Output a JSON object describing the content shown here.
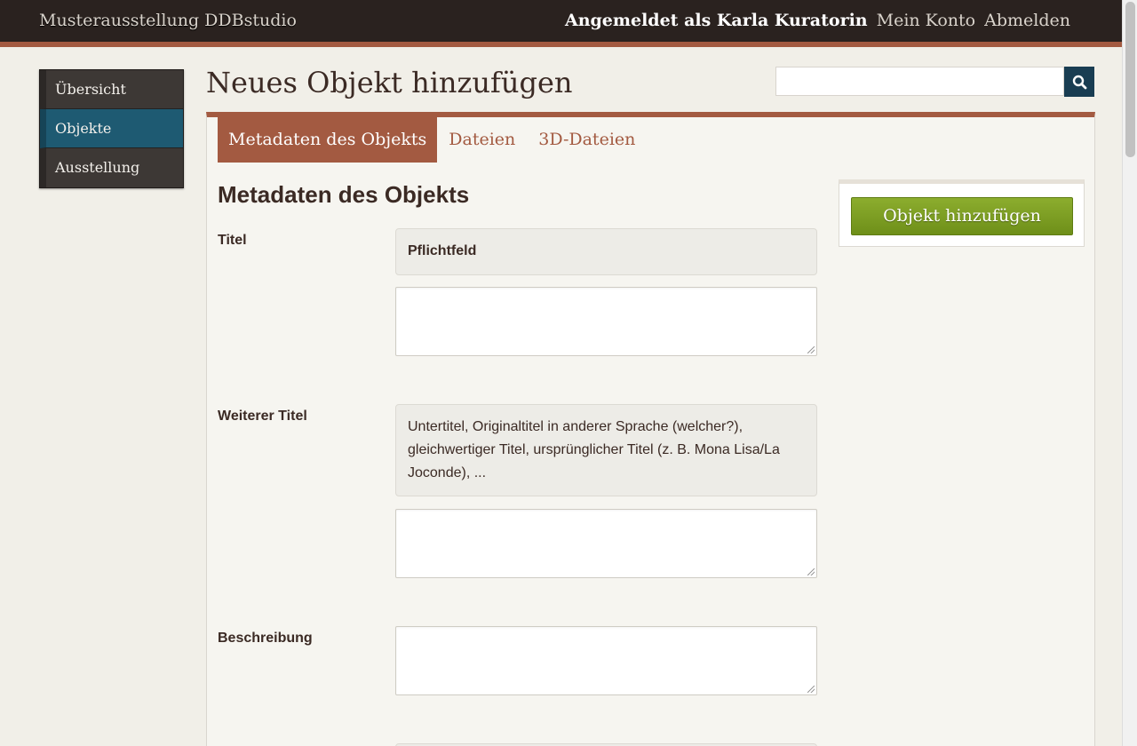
{
  "header": {
    "site_title": "Musterausstellung DDBstudio",
    "logged_in_as": "Angemeldet als Karla Kuratorin",
    "account_link": "Mein Konto",
    "logout_link": "Abmelden"
  },
  "sidebar": {
    "items": [
      {
        "label": "Übersicht",
        "active": false
      },
      {
        "label": "Objekte",
        "active": true
      },
      {
        "label": "Ausstellung",
        "active": false
      }
    ]
  },
  "page": {
    "title": "Neues Objekt hinzufügen"
  },
  "search": {
    "value": "",
    "placeholder": "",
    "icon": "search-icon"
  },
  "tabs": [
    {
      "label": "Metadaten des Objekts",
      "active": true
    },
    {
      "label": "Dateien",
      "active": false
    },
    {
      "label": "3D-Dateien",
      "active": false
    }
  ],
  "form": {
    "section_title": "Metadaten des Objekts",
    "fields": [
      {
        "label": "Titel",
        "hint": "Pflichtfeld",
        "value": ""
      },
      {
        "label": "Weiterer Titel",
        "hint": "Untertitel, Originaltitel in anderer Sprache (welcher?), gleichwertiger Titel, ursprünglicher Titel (z. B. Mona Lisa/La Joconde), ...",
        "value": ""
      },
      {
        "label": "Beschreibung",
        "hint": "",
        "value": ""
      }
    ]
  },
  "actions": {
    "add_object": "Objekt hinzufügen"
  },
  "colors": {
    "accent": "#a35a41",
    "topbar": "#2a221f",
    "active_nav": "#1e5a72",
    "primary_button": "#7a9c22"
  }
}
